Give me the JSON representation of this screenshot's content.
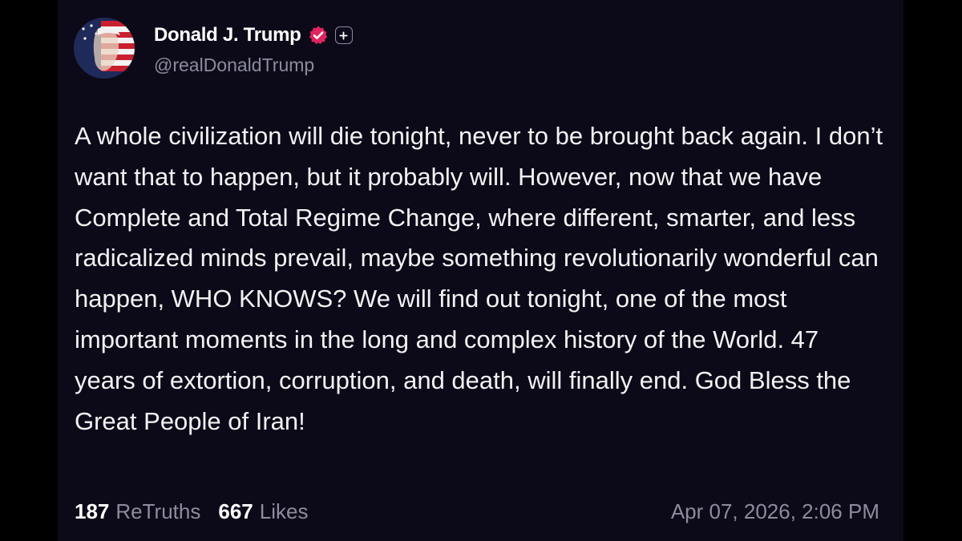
{
  "author": {
    "display_name": "Donald J. Trump",
    "handle": "@realDonaldTrump",
    "verified_icon": "verified-badge-icon",
    "verified_color": "#e0245e",
    "plus_icon": "plus-badge-icon"
  },
  "post": {
    "text": "A whole civilization will die tonight, never to be brought back again. I don’t want that to happen, but it probably will. However, now that we have Complete and Total Regime Change, where different, smarter, and less radicalized minds prevail, maybe something revolutionarily wonderful can happen, WHO KNOWS? We will find out tonight, one of the most important moments in the long and complex history of the World. 47 years of extortion, corruption, and death, will finally end. God Bless the Great People of Iran!"
  },
  "stats": {
    "retruths_count": "187",
    "retruths_label": "ReTruths",
    "likes_count": "667",
    "likes_label": "Likes"
  },
  "timestamp": "Apr 07, 2026, 2:06 PM",
  "colors": {
    "card_background": "#0c0a19",
    "primary_text": "#f2f2f2",
    "secondary_text": "#8c8c9c"
  }
}
